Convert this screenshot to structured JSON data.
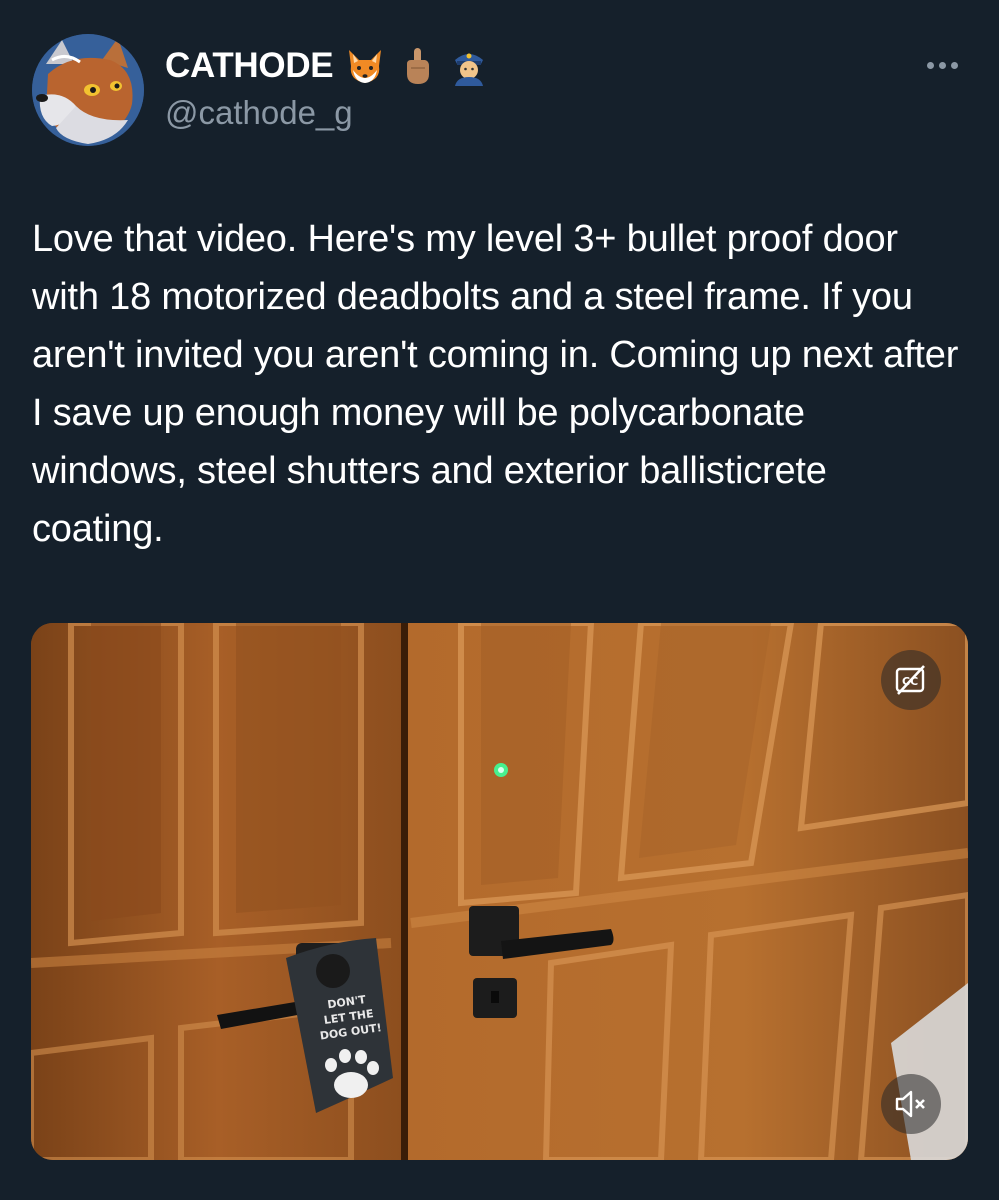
{
  "author": {
    "display_name": "CATHODE",
    "handle": "@cathode_g",
    "badges": [
      "fox-emoji",
      "raised-finger-emoji",
      "police-officer-emoji"
    ]
  },
  "tweet": {
    "text": "Love that video. Here's my level 3+ bullet proof door with 18 motorized deadbolts and a steel frame. If you aren't invited you aren't coming in. Coming up next after I save up enough money will be polycarbonate windows, steel shutters and exterior ballisticrete coating."
  },
  "media": {
    "type": "video",
    "door_hanger_text": "DON'T\nLET THE\nDOG OUT!",
    "controls": [
      "closed-captions-off-icon",
      "muted-speaker-icon"
    ]
  },
  "colors": {
    "background": "#15202b",
    "text_primary": "#ffffff",
    "text_secondary": "#8b98a5",
    "wood": "#a9642a"
  }
}
